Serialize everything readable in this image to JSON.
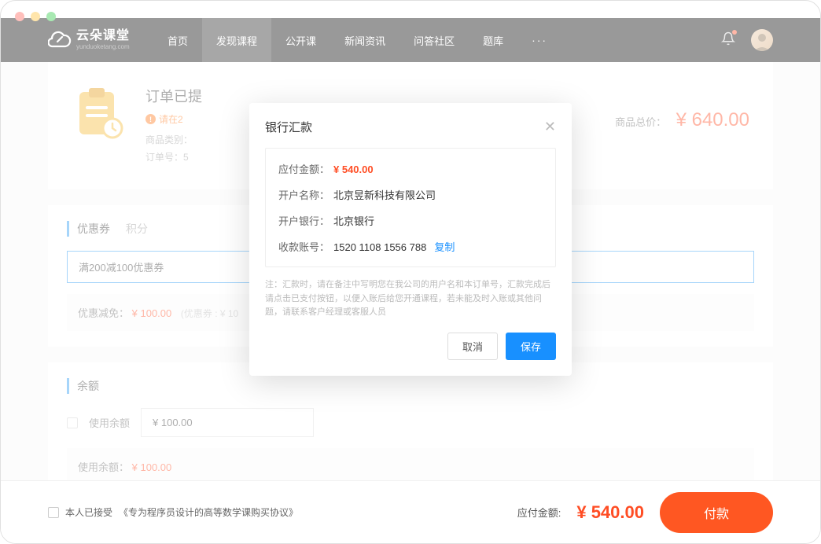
{
  "logo": {
    "main": "云朵课堂",
    "sub": "yunduoketang.com"
  },
  "nav": {
    "items": [
      "首页",
      "发现课程",
      "公开课",
      "新闻资讯",
      "问答社区",
      "题库"
    ],
    "more": "···"
  },
  "order": {
    "title": "订单已提",
    "warning": "请在2",
    "meta_category": "商品类别：",
    "meta_orderno": "订单号：5",
    "total_label": "商品总价：",
    "total_value": "¥ 640.00"
  },
  "coupon": {
    "tab_active": "优惠券",
    "tab_inactive": "积分",
    "selected": "满200减100优惠券",
    "discount_label": "优惠减免：",
    "discount_value": "¥ 100.00",
    "discount_note": "(优惠券 : ¥ 10"
  },
  "balance": {
    "section_title": "余额",
    "use_label": "使用余额",
    "input_value": "¥ 100.00",
    "used_label": "使用余额：",
    "used_value": "¥ 100.00"
  },
  "modal": {
    "title": "银行汇款",
    "amount_label": "应付金额：",
    "amount_value": "¥ 540.00",
    "account_name_label": "开户名称：",
    "account_name_value": "北京昱新科技有限公司",
    "bank_label": "开户银行：",
    "bank_value": "北京银行",
    "account_no_label": "收款账号：",
    "account_no_value": "1520 1108 1556 788",
    "copy": "复制",
    "note": "注：汇款时，请在备注中写明您在我公司的用户名和本订单号，汇款完成后请点击已支付按钮，以便入账后给您开通课程，若未能及时入账或其他问题，请联系客户经理或客服人员",
    "cancel": "取消",
    "save": "保存"
  },
  "footer": {
    "agree_prefix": "本人已接受",
    "agree_link": "《专为程序员设计的高等数学课购买协议》",
    "amount_label": "应付金额:",
    "amount_value": "¥ 540.00",
    "pay_button": "付款"
  }
}
